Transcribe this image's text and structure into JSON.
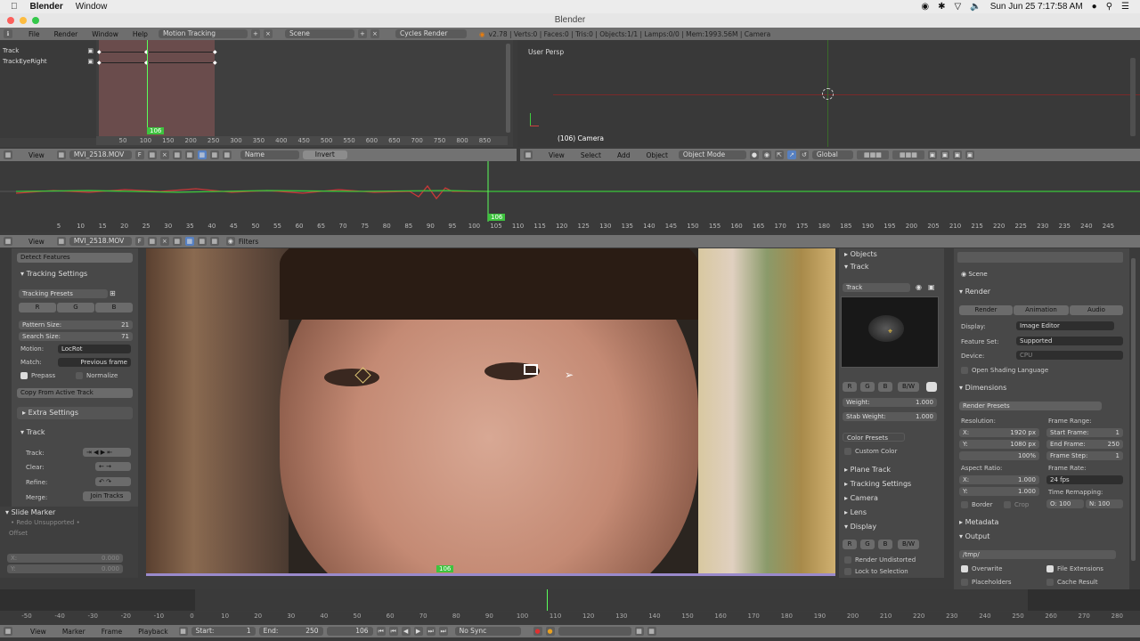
{
  "macbar": {
    "app": "Blender",
    "window": "Window",
    "clock": "Sun Jun 25  7:17:58 AM"
  },
  "title": "Blender",
  "info": {
    "menu_file": "File",
    "menu_render": "Render",
    "menu_window": "Window",
    "menu_help": "Help",
    "screen": "Motion Tracking",
    "scene": "Scene",
    "engine": "Cycles Render",
    "stats": "v2.78 | Verts:0 | Faces:0 | Tris:0 | Objects:1/1 | Lamps:0/0 | Mem:1993.56M | Camera"
  },
  "dopesheet": {
    "tracks": [
      "Track",
      "TrackEyeRight"
    ],
    "frame": "106",
    "ticks": [
      "50",
      "100",
      "150",
      "200",
      "250",
      "300",
      "350",
      "400",
      "450",
      "500",
      "550",
      "600",
      "650",
      "700",
      "750",
      "800",
      "850"
    ]
  },
  "viewport": {
    "label": "User Persp",
    "camera": "(106) Camera",
    "view": "View",
    "select": "Select",
    "add": "Add",
    "object": "Object",
    "mode": "Object Mode",
    "orient": "Global"
  },
  "clip_hdr1": {
    "view": "View",
    "clip": "MVI_2518.MOV",
    "name": "Name",
    "invert": "Invert"
  },
  "graph": {
    "frame": "106",
    "ticks": [
      "5",
      "10",
      "15",
      "20",
      "25",
      "30",
      "35",
      "40",
      "45",
      "50",
      "55",
      "60",
      "65",
      "70",
      "75",
      "80",
      "85",
      "90",
      "95",
      "100",
      "105",
      "110",
      "115",
      "120",
      "125",
      "130",
      "135",
      "140",
      "145",
      "150",
      "155",
      "160",
      "165",
      "170",
      "175",
      "180",
      "185",
      "190",
      "195",
      "200",
      "205",
      "210",
      "215",
      "220",
      "225",
      "230",
      "235",
      "240",
      "245"
    ]
  },
  "clip_hdr2": {
    "view": "View",
    "clip": "MVI_2518.MOV",
    "filters": "Filters"
  },
  "toolshelf": {
    "detect": "Detect Features",
    "tracking_settings": "Tracking Settings",
    "presets": "Tracking Presets",
    "r": "R",
    "g": "G",
    "b": "B",
    "pattern_size": "Pattern Size:",
    "pattern_val": "21",
    "search_size": "Search Size:",
    "search_val": "71",
    "motion": "Motion:",
    "motion_val": "LocRot",
    "match": "Match:",
    "match_val": "Previous frame",
    "prepass": "Prepass",
    "normalize": "Normalize",
    "copy": "Copy From Active Track",
    "extra": "Extra Settings",
    "track": "Track",
    "track_lbl": "Track:",
    "clear": "Clear:",
    "refine": "Refine:",
    "merge": "Merge:",
    "join": "Join Tracks",
    "slide": "Slide Marker",
    "redo": "Redo Unsupported",
    "offset": "Offset",
    "x": "X:",
    "y": "Y:",
    "xval": "0.000",
    "yval": "0.000"
  },
  "clip": {
    "frame": "106"
  },
  "props": {
    "objects": "Objects",
    "track": "Track",
    "track_name": "Track",
    "r": "R",
    "g": "G",
    "b": "B",
    "bw": "B/W",
    "weight": "Weight:",
    "weight_val": "1.000",
    "stab": "Stab Weight:",
    "stab_val": "1.000",
    "color_presets": "Color Presets",
    "custom_color": "Custom Color",
    "plane_track": "Plane Track",
    "tracking_settings": "Tracking Settings",
    "camera": "Camera",
    "lens": "Lens",
    "display": "Display",
    "render_undist": "Render Undistorted",
    "lock_sel": "Lock to Selection"
  },
  "render": {
    "scene": "Scene",
    "render": "Render",
    "tab_render": "Render",
    "tab_anim": "Animation",
    "tab_audio": "Audio",
    "display": "Display:",
    "display_val": "Image Editor",
    "feature": "Feature Set:",
    "feature_val": "Supported",
    "device": "Device:",
    "device_val": "CPU",
    "osl": "Open Shading Language",
    "dimensions": "Dimensions",
    "presets": "Render Presets",
    "resolution": "Resolution:",
    "res_x": "1920 px",
    "res_y": "1080 px",
    "res_pct": "100%",
    "frame_range": "Frame Range:",
    "start": "Start Frame:",
    "start_val": "1",
    "end": "End Frame:",
    "end_val": "250",
    "step": "Frame Step:",
    "step_val": "1",
    "aspect": "Aspect Ratio:",
    "ax": "1.000",
    "ay": "1.000",
    "frame_rate": "Frame Rate:",
    "fps": "24 fps",
    "remap": "Time Remapping:",
    "old": "O: 100",
    "new": "N: 100",
    "border": "Border",
    "crop": "Crop",
    "metadata": "Metadata",
    "output": "Output",
    "path": "/tmp/",
    "overwrite": "Overwrite",
    "file_ext": "File Extensions",
    "placeholders": "Placeholders",
    "cache": "Cache Result",
    "x": "X:",
    "y": "Y:"
  },
  "timeline": {
    "ticks": [
      "-50",
      "-40",
      "-30",
      "-20",
      "-10",
      "0",
      "10",
      "20",
      "30",
      "40",
      "50",
      "60",
      "70",
      "80",
      "90",
      "100",
      "110",
      "120",
      "130",
      "140",
      "150",
      "160",
      "170",
      "180",
      "190",
      "200",
      "210",
      "220",
      "230",
      "240",
      "250",
      "260",
      "270",
      "280"
    ],
    "view": "View",
    "marker": "Marker",
    "frame": "Frame",
    "playback": "Playback",
    "start": "Start:",
    "start_val": "1",
    "end": "End:",
    "end_val": "250",
    "current": "106",
    "sync": "No Sync"
  }
}
